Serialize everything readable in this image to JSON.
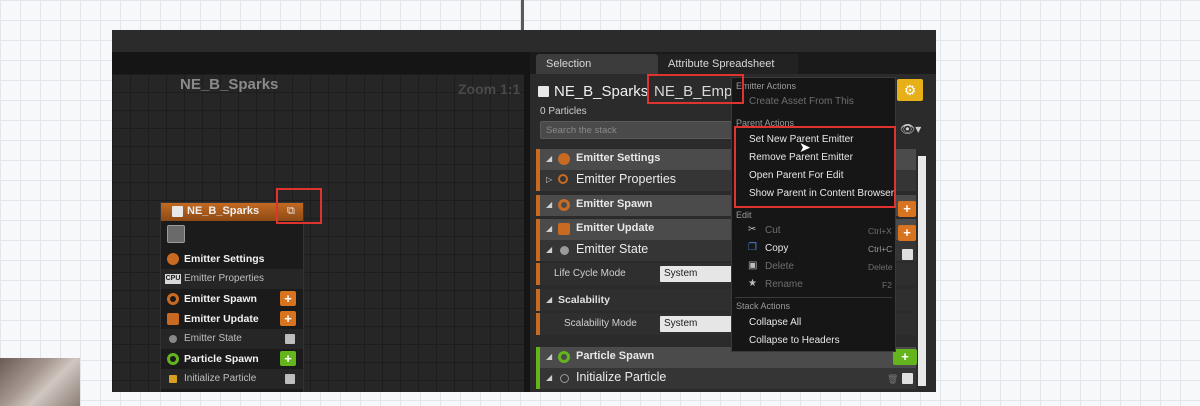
{
  "graph": {
    "title": "NE_B_Sparks",
    "zoom": "Zoom 1:1"
  },
  "node": {
    "title": "NE_B_Sparks",
    "rows": [
      {
        "label": "Emitter Settings"
      },
      {
        "label": "Emitter Properties",
        "badge": "CPU"
      },
      {
        "label": "Emitter Spawn",
        "action": "+"
      },
      {
        "label": "Emitter Update",
        "action": "+"
      },
      {
        "label": "Emitter State"
      },
      {
        "label": "Particle Spawn",
        "action": "+"
      },
      {
        "label": "Initialize Particle"
      }
    ]
  },
  "panel": {
    "tabs": [
      "Selection",
      "Attribute Spreadsheet"
    ],
    "emitter_name": "NE_B_Sparks",
    "parent_name": "NE_B_Empt",
    "particles": "0 Particles",
    "search_placeholder": "Search the stack",
    "stack": {
      "emitter_settings": "Emitter Settings",
      "emitter_properties": "Emitter Properties",
      "emitter_spawn": "Emitter Spawn",
      "emitter_update": "Emitter Update",
      "emitter_state": "Emitter State",
      "life_cycle_label": "Life Cycle Mode",
      "life_cycle_value": "System",
      "scalability": "Scalability",
      "scalability_mode_label": "Scalability Mode",
      "scalability_mode_value": "System",
      "particle_spawn": "Particle Spawn",
      "initialize_particle": "Initialize Particle"
    }
  },
  "context_menu": {
    "emitter_actions": "Emitter Actions",
    "create_asset": "Create Asset From This",
    "parent_actions": "Parent Actions",
    "set_parent": "Set New Parent Emitter",
    "remove_parent": "Remove Parent Emitter",
    "open_parent": "Open Parent For Edit",
    "show_parent": "Show Parent in Content Browser",
    "edit": "Edit",
    "cut": "Cut",
    "cut_sc": "Ctrl+X",
    "copy": "Copy",
    "copy_sc": "Ctrl+C",
    "delete": "Delete",
    "delete_sc": "Delete",
    "rename": "Rename",
    "rename_sc": "F2",
    "stack_actions": "Stack Actions",
    "collapse_all": "Collapse All",
    "collapse_headers": "Collapse to Headers"
  },
  "colors": {
    "accent_orange": "#c86a22",
    "accent_green": "#64b41e",
    "highlight_red": "#e0322f",
    "button_yellow": "#e8b018"
  }
}
